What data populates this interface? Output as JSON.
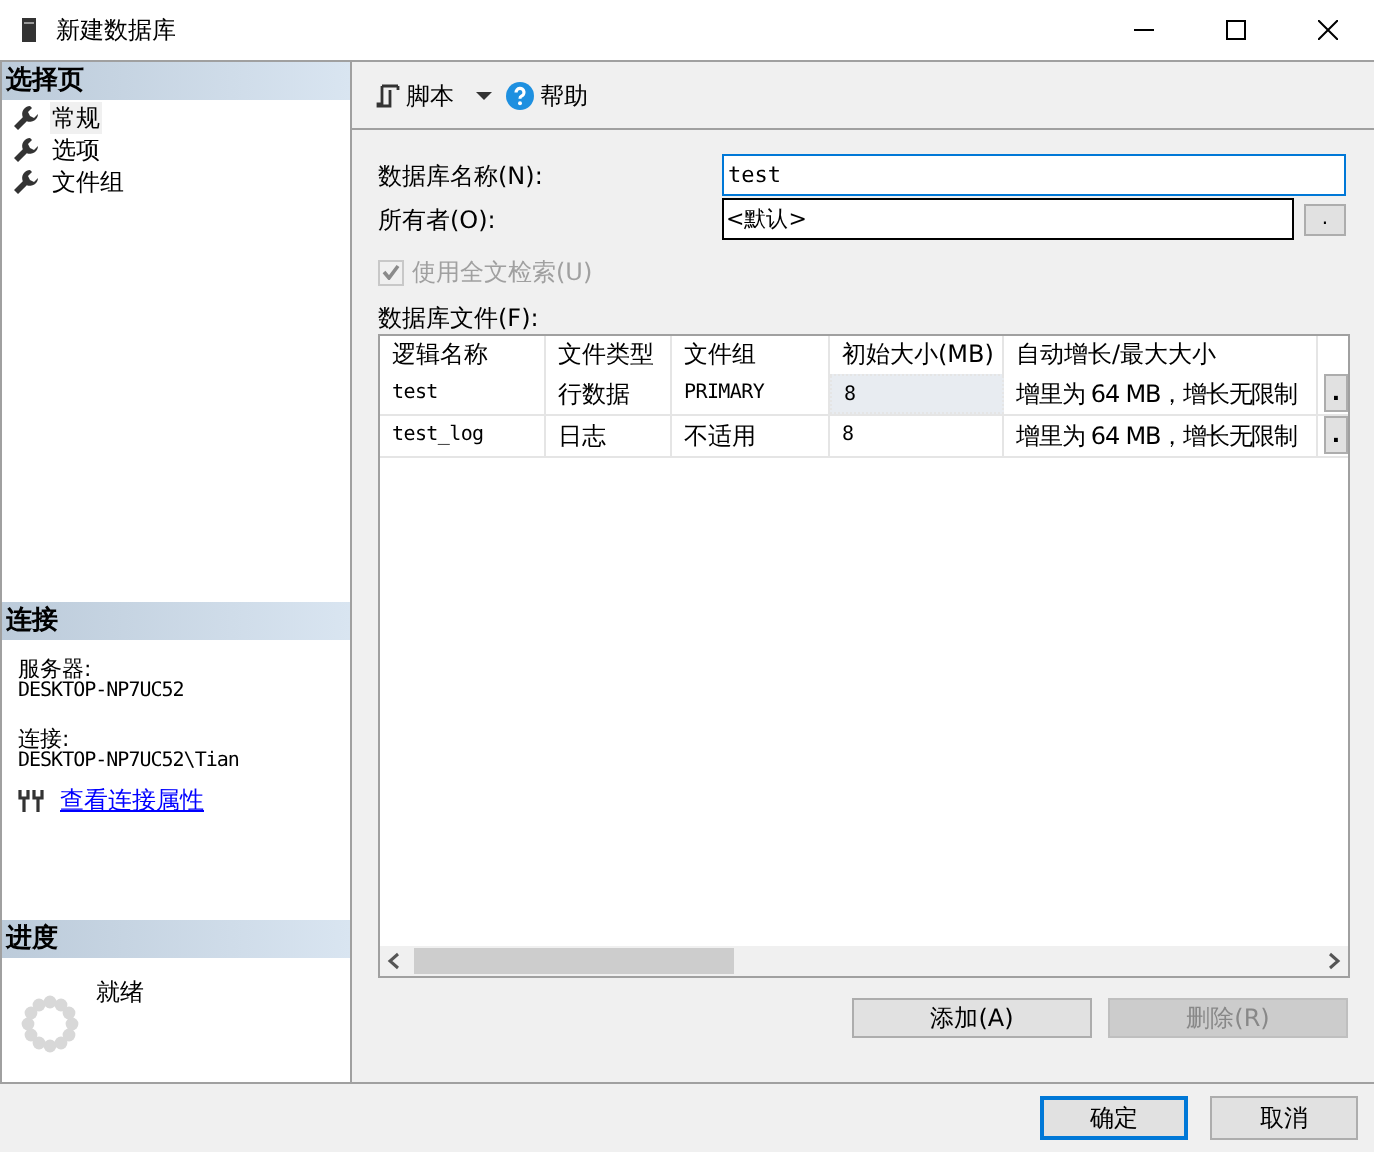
{
  "window": {
    "title": "新建数据库"
  },
  "sidebar": {
    "header": "选择页",
    "items": [
      {
        "label": "常规",
        "selected": true
      },
      {
        "label": "选项",
        "selected": false
      },
      {
        "label": "文件组",
        "selected": false
      }
    ]
  },
  "connection": {
    "header": "连接",
    "server_label": "服务器:",
    "server": "DESKTOP-NP7UC52",
    "connection_label": "连接:",
    "connection": "DESKTOP-NP7UC52\\Tian",
    "link": "查看连接属性"
  },
  "progress": {
    "header": "进度",
    "status": "就绪"
  },
  "toolbar": {
    "script": "脚本",
    "help": "帮助"
  },
  "form": {
    "name_label": "数据库名称(N):",
    "name_value": "test",
    "owner_label": "所有者(O):",
    "owner_value": "<默认>",
    "owner_button": ".",
    "fulltext": {
      "label": "使用全文检索(U)",
      "checked": true,
      "disabled": true
    }
  },
  "files": {
    "label": "数据库文件(F):",
    "columns": [
      "逻辑名称",
      "文件类型",
      "文件组",
      "初始大小(MB)",
      "自动增长/最大大小"
    ],
    "rows": [
      {
        "cells": [
          "test",
          "行数据",
          "PRIMARY",
          "8",
          "增里为 64 MB，增长无限制"
        ],
        "button": ".",
        "focused": true
      },
      {
        "cells": [
          "test_log",
          "日志",
          "不适用",
          "8",
          "增里为 64 MB，增长无限制"
        ],
        "button": ".",
        "focused": false
      }
    ]
  },
  "file_buttons": [
    {
      "label": "添加(A)",
      "disabled": false
    },
    {
      "label": "删除(R)",
      "disabled": true
    }
  ],
  "dialog_buttons": [
    {
      "label": "确定",
      "default": true
    },
    {
      "label": "取消",
      "default": false
    }
  ]
}
